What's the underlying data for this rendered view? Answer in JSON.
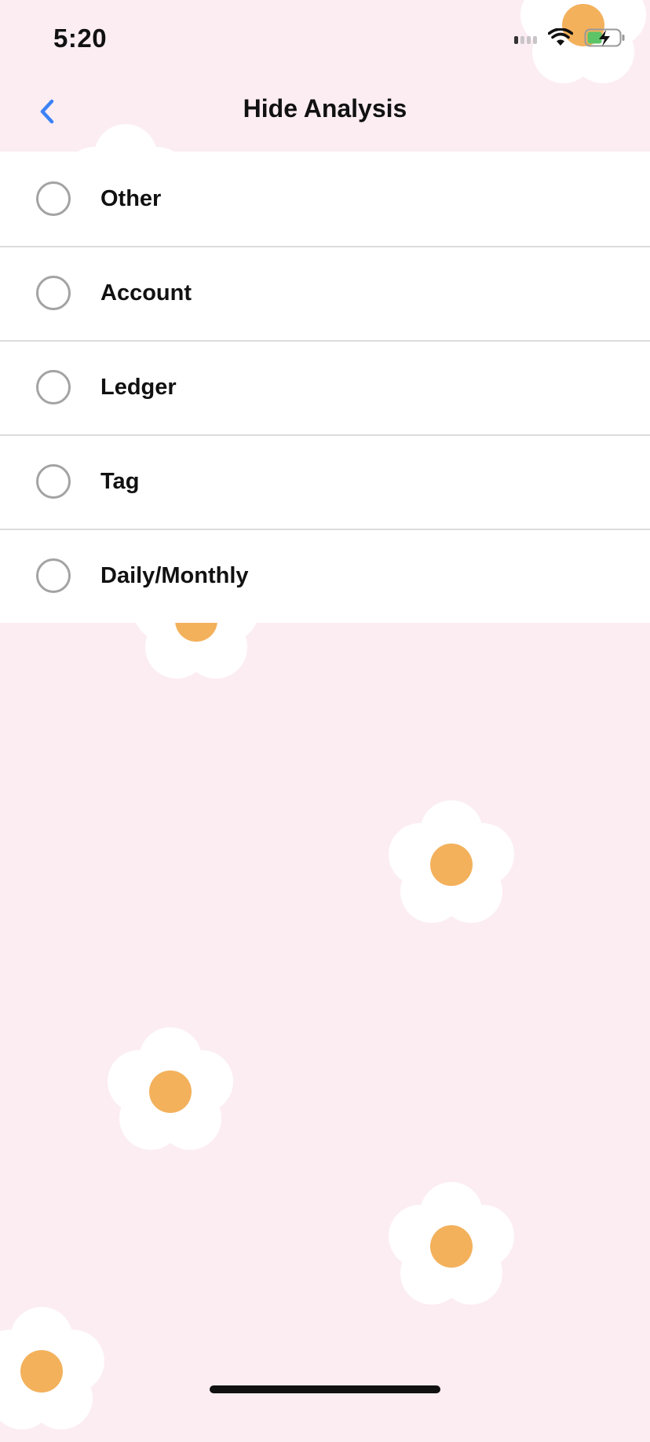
{
  "status_bar": {
    "time": "5:20"
  },
  "nav": {
    "title": "Hide Analysis",
    "back_icon": "chevron-left-icon",
    "accent_color": "#3b82f6"
  },
  "options": [
    {
      "label": "Other",
      "selected": false
    },
    {
      "label": "Account",
      "selected": false
    },
    {
      "label": "Ledger",
      "selected": false
    },
    {
      "label": "Tag",
      "selected": false
    },
    {
      "label": "Daily/Monthly",
      "selected": false
    }
  ],
  "theme": {
    "background": "#fcedf3",
    "flower_petal": "#ffffff",
    "flower_center": "#f3b15c"
  }
}
